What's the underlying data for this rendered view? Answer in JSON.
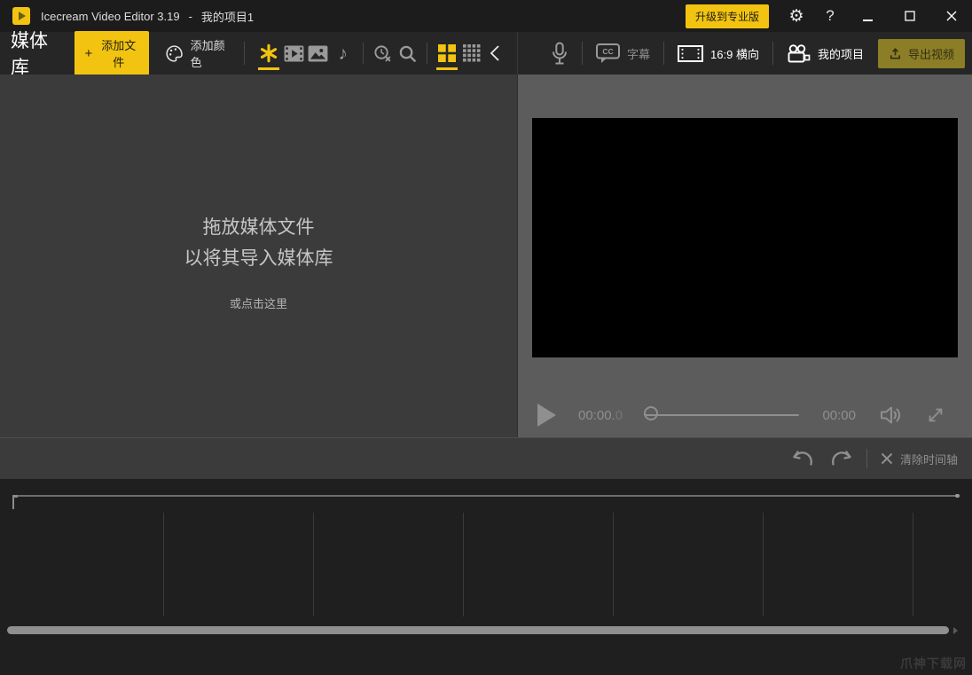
{
  "titlebar": {
    "app_title": "Icecream Video Editor 3.19",
    "separator": "-",
    "project_name": "我的项目1",
    "upgrade_label": "升级到专业版",
    "help_glyph": "?",
    "gear_glyph": "⚙"
  },
  "toolbar": {
    "panel_title": "媒体库",
    "add_files_plus": "+",
    "add_files_label": "添加文件",
    "add_color_label": "添加颜色",
    "music_note_glyph": "♪"
  },
  "preview_toolbar": {
    "subtitles_label": "字幕",
    "cc_glyph": "CC",
    "aspect_label": "16:9 横向",
    "projects_label": "我的项目",
    "export_label": "导出视频"
  },
  "media_library": {
    "drop_hint_line1": "拖放媒体文件",
    "drop_hint_line2": "以将其导入媒体库",
    "drop_hint_line3": "或点击这里"
  },
  "player": {
    "current_time": "00:00.",
    "current_time_fraction": "0",
    "total_time": "00:00"
  },
  "timeline": {
    "clear_label": "清除时间轴"
  },
  "watermark_text": "爪神下载网",
  "colors": {
    "accent_yellow": "#f2c411",
    "export_button_olive": "#8c7e26",
    "titlebar_bg": "#1c1c1c",
    "toolbar_bg": "#262626",
    "media_panel_bg": "#3b3b3b",
    "preview_panel_bg": "#5c5c5c",
    "timeline_bg": "#1f1f1f",
    "video_bg": "#000000",
    "dim_icon": "#9a9a9a",
    "player_icon": "#8f8f8f"
  }
}
